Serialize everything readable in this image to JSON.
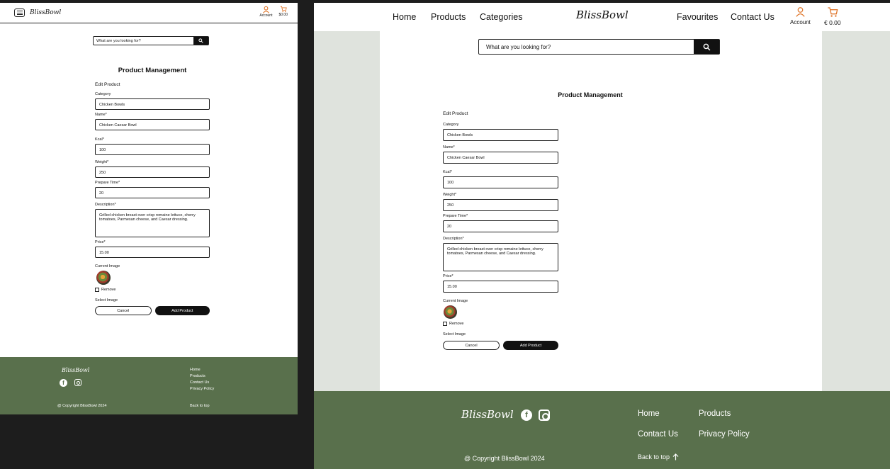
{
  "brand": {
    "logo": "BlissBowl",
    "accent_color": "#e0782e",
    "footer_color": "#59704c"
  },
  "mobile": {
    "account_label": "Account",
    "cart_total": "$0.00",
    "search_placeholder": "What are you looking for?",
    "page_title": "Product Management",
    "form": {
      "subtitle": "Edit Product",
      "category_label": "Category",
      "category_value": "Chicken Bowls",
      "name_label": "Name*",
      "name_value": "Chicken Caesar Bowl",
      "kcal_label": "Kcal*",
      "kcal_value": "100",
      "weight_label": "Weight*",
      "weight_value": "250",
      "prepare_label": "Prepare Time*",
      "prepare_value": "20",
      "description_label": "Description*",
      "description_value": "Grilled chicken breast over crisp romaine lettuce, cherry tomatoes, Parmesan cheese, and Caesar dressing.",
      "price_label": "Price*",
      "price_value": "15.00",
      "current_image_label": "Current Image",
      "remove_label": "Remove",
      "select_image_label": "Select Image",
      "cancel_label": "Cancel",
      "submit_label": "Add Product"
    },
    "footer": {
      "links": [
        "Home",
        "Products",
        "Contact Us",
        "Privacy Policy"
      ],
      "copyright": "@ Copyright BlissBowl 2024",
      "back_to_top": "Back to top"
    }
  },
  "desktop": {
    "nav": [
      "Home",
      "Products",
      "Categories",
      "Favourites",
      "Contact Us"
    ],
    "account_label": "Account",
    "cart_total": "€ 0.00",
    "search_placeholder": "What are you looking for?",
    "page_title": "Product Management",
    "form": {
      "subtitle": "Edit Product",
      "category_label": "Category",
      "category_value": "Chicken Bowls",
      "name_label": "Name*",
      "name_value": "Chicken Caesar Bowl",
      "kcal_label": "Kcal*",
      "kcal_value": "100",
      "weight_label": "Weight*",
      "weight_value": "250",
      "prepare_label": "Prepare Time*",
      "prepare_value": "20",
      "description_label": "Description*",
      "description_value": "Grilled chicken breast over crisp romaine lettuce, cherry tomatoes, Parmesan cheese, and Caesar dressing.",
      "price_label": "Price*",
      "price_value": "15.00",
      "current_image_label": "Current Image",
      "remove_label": "Remove",
      "select_image_label": "Select Image",
      "cancel_label": "Cancel",
      "submit_label": "Add Product"
    },
    "footer": {
      "links": [
        "Home",
        "Products",
        "Contact Us",
        "Privacy Policy"
      ],
      "copyright": "@ Copyright BlissBowl 2024",
      "back_to_top": "Back to top"
    }
  }
}
